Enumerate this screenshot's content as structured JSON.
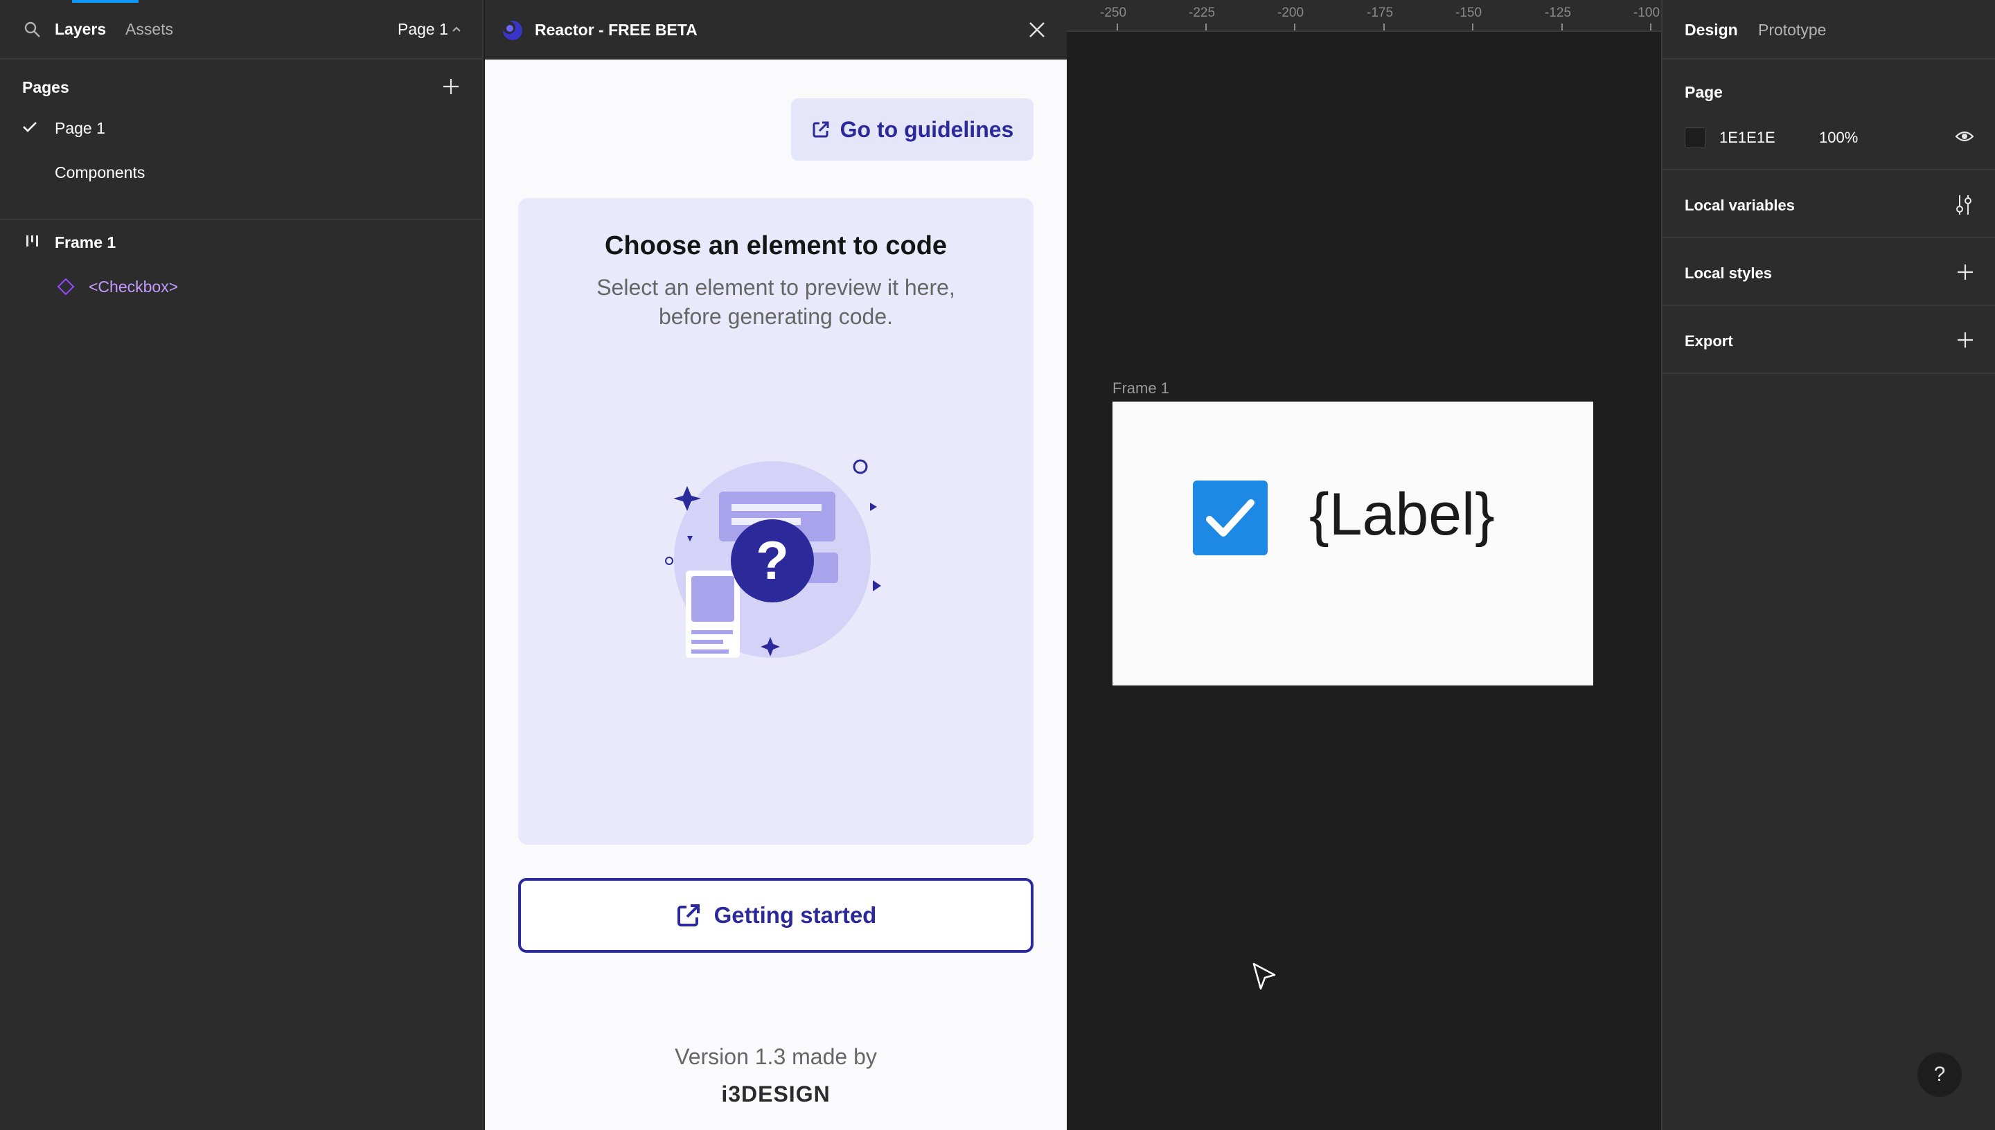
{
  "left_panel": {
    "tabs": {
      "layers": "Layers",
      "assets": "Assets"
    },
    "page_selector": "Page 1",
    "pages_header": "Pages",
    "pages": [
      {
        "label": "Page 1",
        "selected": true
      },
      {
        "label": "Components",
        "selected": false
      }
    ],
    "layers": [
      {
        "label": "Frame 1",
        "kind": "frame"
      },
      {
        "label": "<Checkbox>",
        "kind": "component-instance"
      }
    ]
  },
  "plugin": {
    "title": "Reactor - FREE BETA",
    "guidelines_button": "Go to guidelines",
    "preview_title": "Choose an element to code",
    "preview_desc_line1": "Select an element to preview it here,",
    "preview_desc_line2": "before generating code.",
    "getting_started_button": "Getting started",
    "version_text": "Version 1.3 made by",
    "brand_logo_text": "i3DESIGN",
    "accent_color": "#2c2a9b"
  },
  "canvas": {
    "ruler_ticks": [
      "-250",
      "-225",
      "-200",
      "-175",
      "-150",
      "-125",
      "-100"
    ],
    "frame_label": "Frame 1",
    "checkbox_label": "{Label}",
    "checkbox_checked": true,
    "checkbox_color": "#1e88e5"
  },
  "right_panel": {
    "tabs": {
      "design": "Design",
      "prototype": "Prototype"
    },
    "page_section_title": "Page",
    "page_bg_color": "1E1E1E",
    "page_bg_opacity": "100%",
    "local_variables": "Local variables",
    "local_styles": "Local styles",
    "export": "Export",
    "help": "?"
  }
}
